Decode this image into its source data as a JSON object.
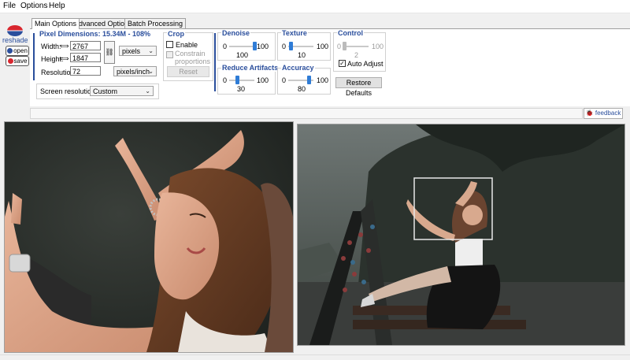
{
  "menu": {
    "items": [
      "File",
      "Options",
      "Help"
    ]
  },
  "logo": {
    "text": "reshade"
  },
  "side_buttons": {
    "open": "open",
    "save": "save"
  },
  "tabs": [
    {
      "label": "Main Options"
    },
    {
      "label": "Advanced Options"
    },
    {
      "label": "Batch Processing"
    }
  ],
  "pixel_dimensions": {
    "title": "Pixel Dimensions: 15.34M - 108%",
    "width_label": "Width:",
    "width_value": "2767",
    "height_label": "Height:",
    "height_value": "1847",
    "unit": "pixels",
    "resolution_label": "Resolution:",
    "resolution_value": "72",
    "resolution_unit": "pixels/inch"
  },
  "screen_resolution": {
    "label": "Screen resolution",
    "value": "Custom"
  },
  "crop": {
    "title": "Crop",
    "enable_label": "Enable",
    "enable_checked": false,
    "constrain_label": "Constrain proportions",
    "reset_label": "Reset"
  },
  "sliders": {
    "denoise": {
      "title": "Denoise",
      "min": "0",
      "max": "100",
      "value": "100",
      "level": 1.0
    },
    "texture": {
      "title": "Texture",
      "min": "0",
      "max": "100",
      "value": "10",
      "level": 0.1
    },
    "control": {
      "title": "Control",
      "min": "0",
      "max": "100",
      "value": "2",
      "level": 0.02,
      "auto_adjust_label": "Auto Adjust",
      "auto_adjust_checked": true
    },
    "reduce_artifacts": {
      "title": "Reduce Artifacts",
      "min": "0",
      "max": "100",
      "value": "30",
      "level": 0.3
    },
    "accuracy": {
      "title": "Accuracy",
      "min": "0",
      "max": "100",
      "value": "80",
      "level": 0.8
    }
  },
  "restore_defaults": "Restore Defaults",
  "feedback": "feedback",
  "colors": {
    "accent": "#2a4e9c",
    "slider_thumb": "#2f7cd6",
    "logo_red": "#d8262e"
  }
}
